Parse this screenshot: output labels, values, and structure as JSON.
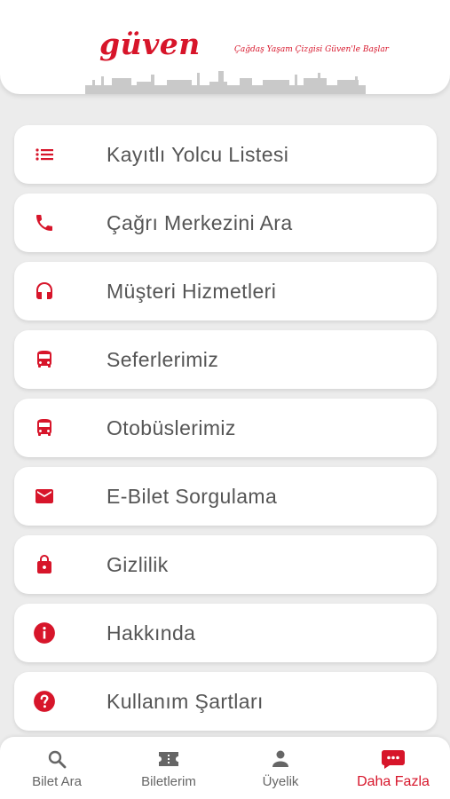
{
  "header": {
    "logo_text": "güven",
    "slogan": "Çağdaş Yaşam Çizgisi Güven'le Başlar"
  },
  "menu": [
    {
      "label": "Kayıtlı Yolcu Listesi",
      "icon": "list-icon"
    },
    {
      "label": "Çağrı Merkezini Ara",
      "icon": "phone-icon"
    },
    {
      "label": "Müşteri Hizmetleri",
      "icon": "headset-icon"
    },
    {
      "label": "Seferlerimiz",
      "icon": "bus-icon"
    },
    {
      "label": "Otobüslerimiz",
      "icon": "bus-icon"
    },
    {
      "label": "E-Bilet Sorgulama",
      "icon": "mail-icon"
    },
    {
      "label": "Gizlilik",
      "icon": "lock-icon"
    },
    {
      "label": "Hakkında",
      "icon": "info-icon"
    },
    {
      "label": "Kullanım Şartları",
      "icon": "help-icon"
    }
  ],
  "tabs": [
    {
      "label": "Bilet Ara",
      "icon": "search-icon"
    },
    {
      "label": "Biletlerim",
      "icon": "ticket-icon"
    },
    {
      "label": "Üyelik",
      "icon": "person-icon"
    },
    {
      "label": "Daha Fazla",
      "icon": "more-chat-icon",
      "active": true
    }
  ],
  "colors": {
    "accent": "#d7152a",
    "background": "#ececec",
    "card": "#ffffff",
    "text": "#555555",
    "tab_inactive": "#666666"
  }
}
